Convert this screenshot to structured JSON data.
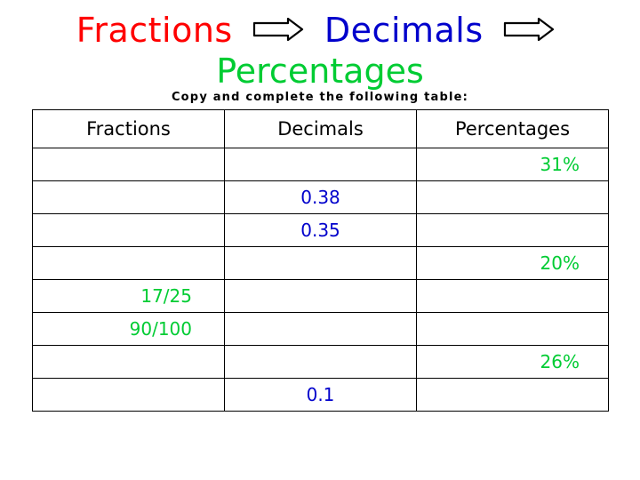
{
  "title": {
    "word1": "Fractions",
    "word2": "Decimals",
    "word3": "Percentages",
    "arrow1_name": "right-arrow-icon",
    "arrow2_name": "right-arrow-icon",
    "color_word1": "#ff0000",
    "color_word2": "#0000cc",
    "color_word3": "#00cc33"
  },
  "instruction": "Copy and complete the following table:",
  "table": {
    "headers": [
      "Fractions",
      "Decimals",
      "Percentages"
    ],
    "rows": [
      {
        "fraction": "",
        "decimal": "",
        "percentage": "31%"
      },
      {
        "fraction": "",
        "decimal": "0.38",
        "percentage": ""
      },
      {
        "fraction": "",
        "decimal": "0.35",
        "percentage": ""
      },
      {
        "fraction": "",
        "decimal": "",
        "percentage": "20%"
      },
      {
        "fraction": "17/25",
        "decimal": "",
        "percentage": ""
      },
      {
        "fraction": "90/100",
        "decimal": "",
        "percentage": ""
      },
      {
        "fraction": "",
        "decimal": "",
        "percentage": "26%"
      },
      {
        "fraction": "",
        "decimal": "0.1",
        "percentage": ""
      }
    ]
  }
}
